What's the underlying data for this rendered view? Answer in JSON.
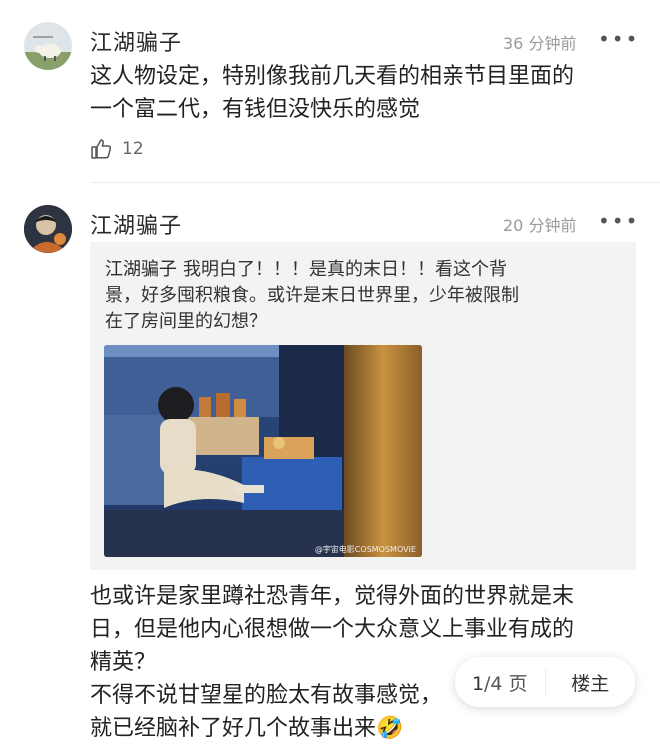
{
  "comments": [
    {
      "username": "江湖骗子",
      "time": "36 分钟前",
      "more": "•••",
      "text_lines": [
        "这人物设定，特别像我前几天看的相亲节目里面的",
        "一个富二代，有钱但没快乐的感觉"
      ],
      "likes": "12"
    },
    {
      "username": "江湖骗子",
      "time": "20 分钟前",
      "more": "•••",
      "quote": {
        "username": "江湖骗子",
        "text_lines": [
          "我明白了！！！是真的末日！！看这个背",
          "景，好多囤积粮食。或许是末日世界里，少年被限制",
          "在了房间里的幻想？"
        ],
        "image_watermark": "@宇宙电影COSMOSMOVIE"
      },
      "text_lines": [
        "也或许是家里蹲社恐青年，觉得外面的世界就是末",
        "日，但是他内心很想做一个大众意义上事业有成的",
        "精英？",
        "不得不说甘望星的脸太有故事感觉，",
        "就已经脑补了好几个故事出来🤣"
      ]
    }
  ],
  "pager": {
    "current": "1",
    "total": "/4 页",
    "floor_label": "楼主"
  },
  "colors": {
    "text": "#222222",
    "meta": "#9a9a9a",
    "quote_bg": "#f3f3f3"
  },
  "icons": [
    "thumbs-up-icon",
    "more-icon"
  ]
}
